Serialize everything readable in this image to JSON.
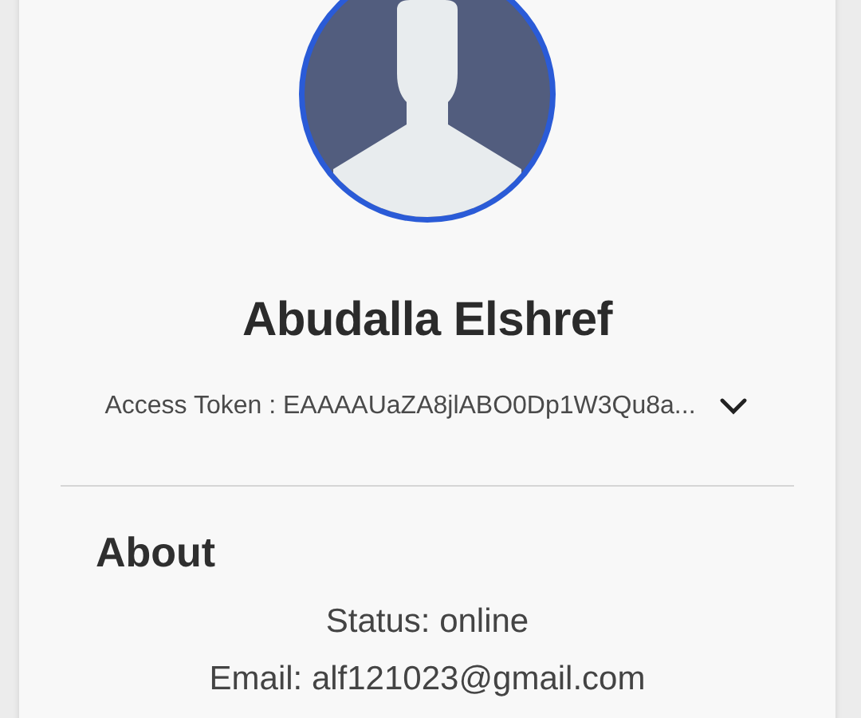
{
  "profile": {
    "name": "Abudalla Elshref",
    "access_token": "Access Token : EAAAAUaZA8jlABO0Dp1W3Qu8a...",
    "token_expanded": false
  },
  "about": {
    "title": "About",
    "lines": [
      "Status: online",
      "Email: alf121023@gmail.com"
    ]
  }
}
